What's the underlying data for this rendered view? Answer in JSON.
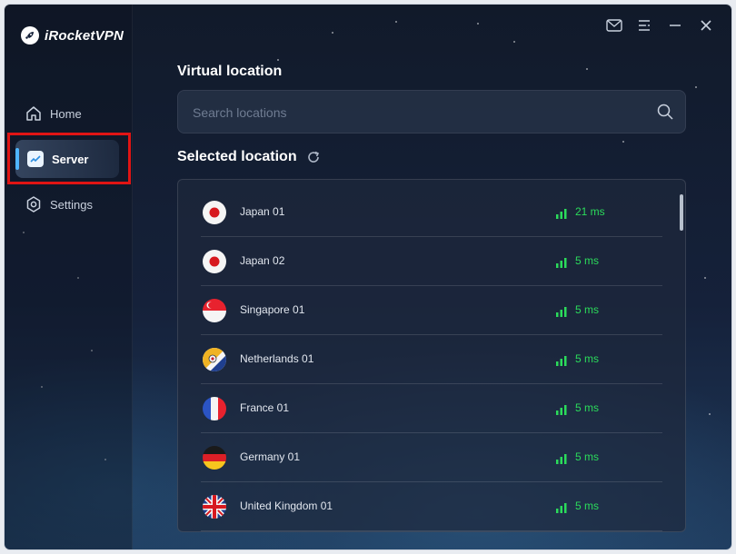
{
  "app": {
    "name": "iRocketVPN"
  },
  "nav": {
    "items": [
      {
        "label": "Home",
        "icon": "home-icon"
      },
      {
        "label": "Server",
        "icon": "server-chart-icon"
      },
      {
        "label": "Settings",
        "icon": "gear-icon"
      }
    ],
    "active_index": 1
  },
  "titlebar": {
    "icons": [
      "mail-icon",
      "menu-icon",
      "minimize-icon",
      "close-icon"
    ]
  },
  "main": {
    "virtual_location_title": "Virtual location",
    "search": {
      "placeholder": "Search locations",
      "value": ""
    },
    "selected_location_title": "Selected location",
    "locations": [
      {
        "name": "Japan 01",
        "ping": "21 ms",
        "flag": "japan"
      },
      {
        "name": "Japan 02",
        "ping": "5 ms",
        "flag": "japan"
      },
      {
        "name": "Singapore 01",
        "ping": "5 ms",
        "flag": "singapore"
      },
      {
        "name": "Netherlands 01",
        "ping": "5 ms",
        "flag": "netherlands"
      },
      {
        "name": "France 01",
        "ping": "5 ms",
        "flag": "france"
      },
      {
        "name": "Germany 01",
        "ping": "5 ms",
        "flag": "germany"
      },
      {
        "name": "United Kingdom 01",
        "ping": "5 ms",
        "flag": "united-kingdom"
      }
    ]
  },
  "colors": {
    "accent": "#4fb6ff",
    "ping_good": "#2bdc5b",
    "highlight": "#e01414"
  }
}
